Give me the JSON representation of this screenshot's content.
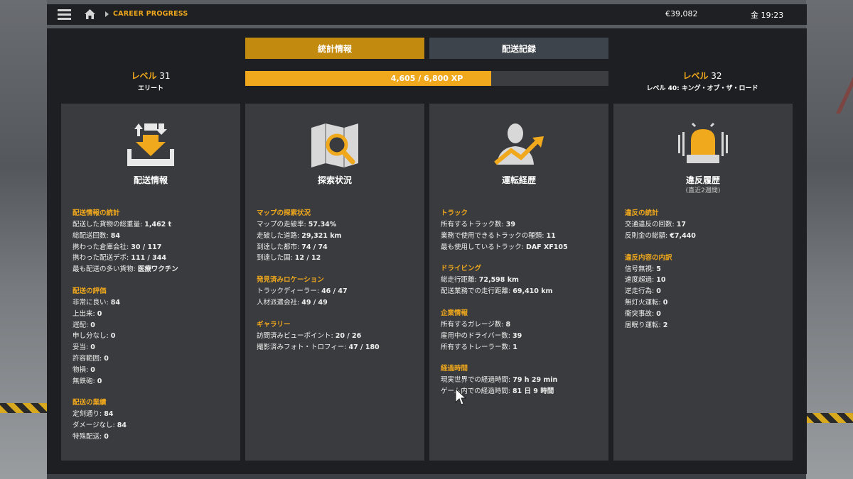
{
  "topbar": {
    "breadcrumb": "CAREER PROGRESS",
    "money": "€39,082",
    "clock": "金 19:23"
  },
  "tabs": [
    {
      "label": "統計情報",
      "active": true
    },
    {
      "label": "配送記録",
      "active": false
    }
  ],
  "level": {
    "current_label": "レベル",
    "current_value": "31",
    "current_rank": "エリート",
    "next_label": "レベル",
    "next_value": "32",
    "next_sub": "レベル 40: キング・オブ・ザ・ロード",
    "xp_text": "4,605 / 6,800 XP",
    "xp_fraction": 0.677
  },
  "cards": [
    {
      "title": "配送情報",
      "icon": "delivery-icon",
      "sections": [
        {
          "heading": "配送情報の統計",
          "rows": [
            [
              "配送した貨物の総重量: ",
              "1,462 t"
            ],
            [
              "総配送回数: ",
              "84"
            ],
            [
              "携わった倉庫会社: ",
              "30 / 117"
            ],
            [
              "携わった配送デポ: ",
              "111 / 344"
            ],
            [
              "最も配送の多い貨物: ",
              "医療ワクチン"
            ]
          ]
        },
        {
          "heading": "配送の評価",
          "rows": [
            [
              "非常に良い: ",
              "84"
            ],
            [
              "上出来: ",
              "0"
            ],
            [
              "遅配: ",
              "0"
            ],
            [
              "申し分なし: ",
              "0"
            ],
            [
              "妥当: ",
              "0"
            ],
            [
              "許容範囲: ",
              "0"
            ],
            [
              "物損: ",
              "0"
            ],
            [
              "無鉄砲: ",
              "0"
            ]
          ]
        },
        {
          "heading": "配送の業績",
          "rows": [
            [
              "定刻通り: ",
              "84"
            ],
            [
              "ダメージなし: ",
              "84"
            ],
            [
              "特殊配送: ",
              "0"
            ]
          ]
        }
      ]
    },
    {
      "title": "探索状況",
      "icon": "map-search-icon",
      "sections": [
        {
          "heading": "マップの探索状況",
          "rows": [
            [
              "マップの走破率: ",
              "57.34%"
            ],
            [
              "走破した道路: ",
              "29,321 km"
            ],
            [
              "到達した都市: ",
              "74 / 74"
            ],
            [
              "到達した国: ",
              "12 / 12"
            ]
          ]
        },
        {
          "heading": "発見済みロケーション",
          "rows": [
            [
              "トラックディーラー: ",
              "46 / 47"
            ],
            [
              "人材派遣会社: ",
              "49 / 49"
            ]
          ]
        },
        {
          "heading": "ギャラリー",
          "rows": [
            [
              "訪問済みビューポイント: ",
              "20 / 26"
            ],
            [
              "撮影済みフォト・トロフィー: ",
              "47 / 180"
            ]
          ]
        }
      ]
    },
    {
      "title": "運転経歴",
      "icon": "driver-growth-icon",
      "sections": [
        {
          "heading": "トラック",
          "rows": [
            [
              "所有するトラック数: ",
              "39"
            ],
            [
              "業務で使用できるトラックの種類: ",
              "11"
            ],
            [
              "最も使用しているトラック: ",
              "DAF XF105"
            ]
          ]
        },
        {
          "heading": "ドライビング",
          "rows": [
            [
              "総走行距離: ",
              "72,598 km"
            ],
            [
              "配送業務での走行距離: ",
              "69,410 km"
            ]
          ]
        },
        {
          "heading": "企業情報",
          "rows": [
            [
              "所有するガレージ数: ",
              "8"
            ],
            [
              "雇用中のドライバー数: ",
              "39"
            ],
            [
              "所有するトレーラー数: ",
              "1"
            ]
          ]
        },
        {
          "heading": "経過時間",
          "rows": [
            [
              "現実世界での経過時間: ",
              "79 h 29 min"
            ],
            [
              "ゲーム内での経過時間: ",
              "81 日 9 時間"
            ]
          ]
        }
      ]
    },
    {
      "title": "違反履歴",
      "subtitle": "(直近2週間)",
      "icon": "siren-icon",
      "sections": [
        {
          "heading": "違反の統計",
          "rows": [
            [
              "交通違反の回数: ",
              "17"
            ],
            [
              "反則金の総額: ",
              "€7,440"
            ]
          ]
        },
        {
          "heading": "違反内容の内訳",
          "rows": [
            [
              "信号無視: ",
              "5"
            ],
            [
              "速度超過: ",
              "10"
            ],
            [
              "逆走行為: ",
              "0"
            ],
            [
              "無灯火運転: ",
              "0"
            ],
            [
              "衝突事故: ",
              "0"
            ],
            [
              "居眠り運転: ",
              "2"
            ]
          ]
        }
      ]
    }
  ]
}
